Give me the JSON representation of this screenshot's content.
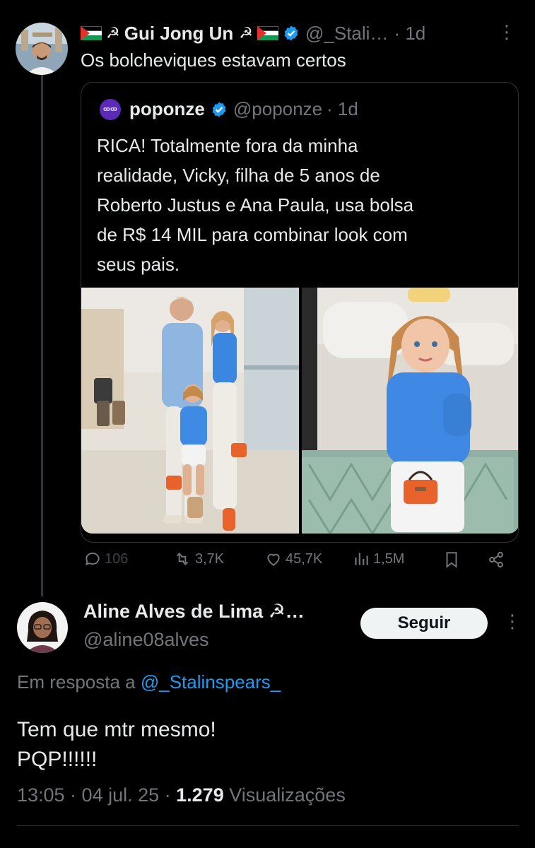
{
  "tweet": {
    "author_name": "Gui Jong Un",
    "author_handle": "@_Stali…",
    "time": "· 1d",
    "text": "Os bolcheviques estavam certos",
    "more": "·"
  },
  "quoted": {
    "logo_text": "ꝏꝏ",
    "author_name": "poponze",
    "author_handle": "@poponze",
    "time": "· 1d",
    "text_lines": [
      "RICA! Totalmente fora da minha",
      "realidade, Vicky, filha de 5 anos de",
      "Roberto Justus e Ana Paula, usa bolsa",
      "de R$ 14 MIL para combinar look com",
      "seus pais."
    ]
  },
  "actions": {
    "replies": "106",
    "reposts": "3,7K",
    "likes": "45,7K",
    "views": "1,5M"
  },
  "reply": {
    "author_name": "Aline Alves de Lima ☭…",
    "author_handle": "@aline08alves",
    "follow_label": "Seguir",
    "replying_prefix": "Em resposta a ",
    "replying_to": "@_Stalinspears_",
    "text_lines": [
      "Tem que mtr mesmo!",
      "PQP!!!!!!"
    ],
    "time": "13:05 · 04 jul. 25 · ",
    "views_count": "1.279",
    "views_label": " Visualizações"
  },
  "symbols": {
    "hammer_sickle": "☭"
  },
  "colors": {
    "background": "#000000",
    "text": "#e7e9ea",
    "muted": "#71767b",
    "link": "#1d9bf0",
    "verified": "#1d9bf0"
  },
  "icons": [
    "reply-icon",
    "repost-icon",
    "like-icon",
    "views-icon",
    "bookmark-icon",
    "share-icon",
    "verified-icon",
    "more-icon"
  ]
}
